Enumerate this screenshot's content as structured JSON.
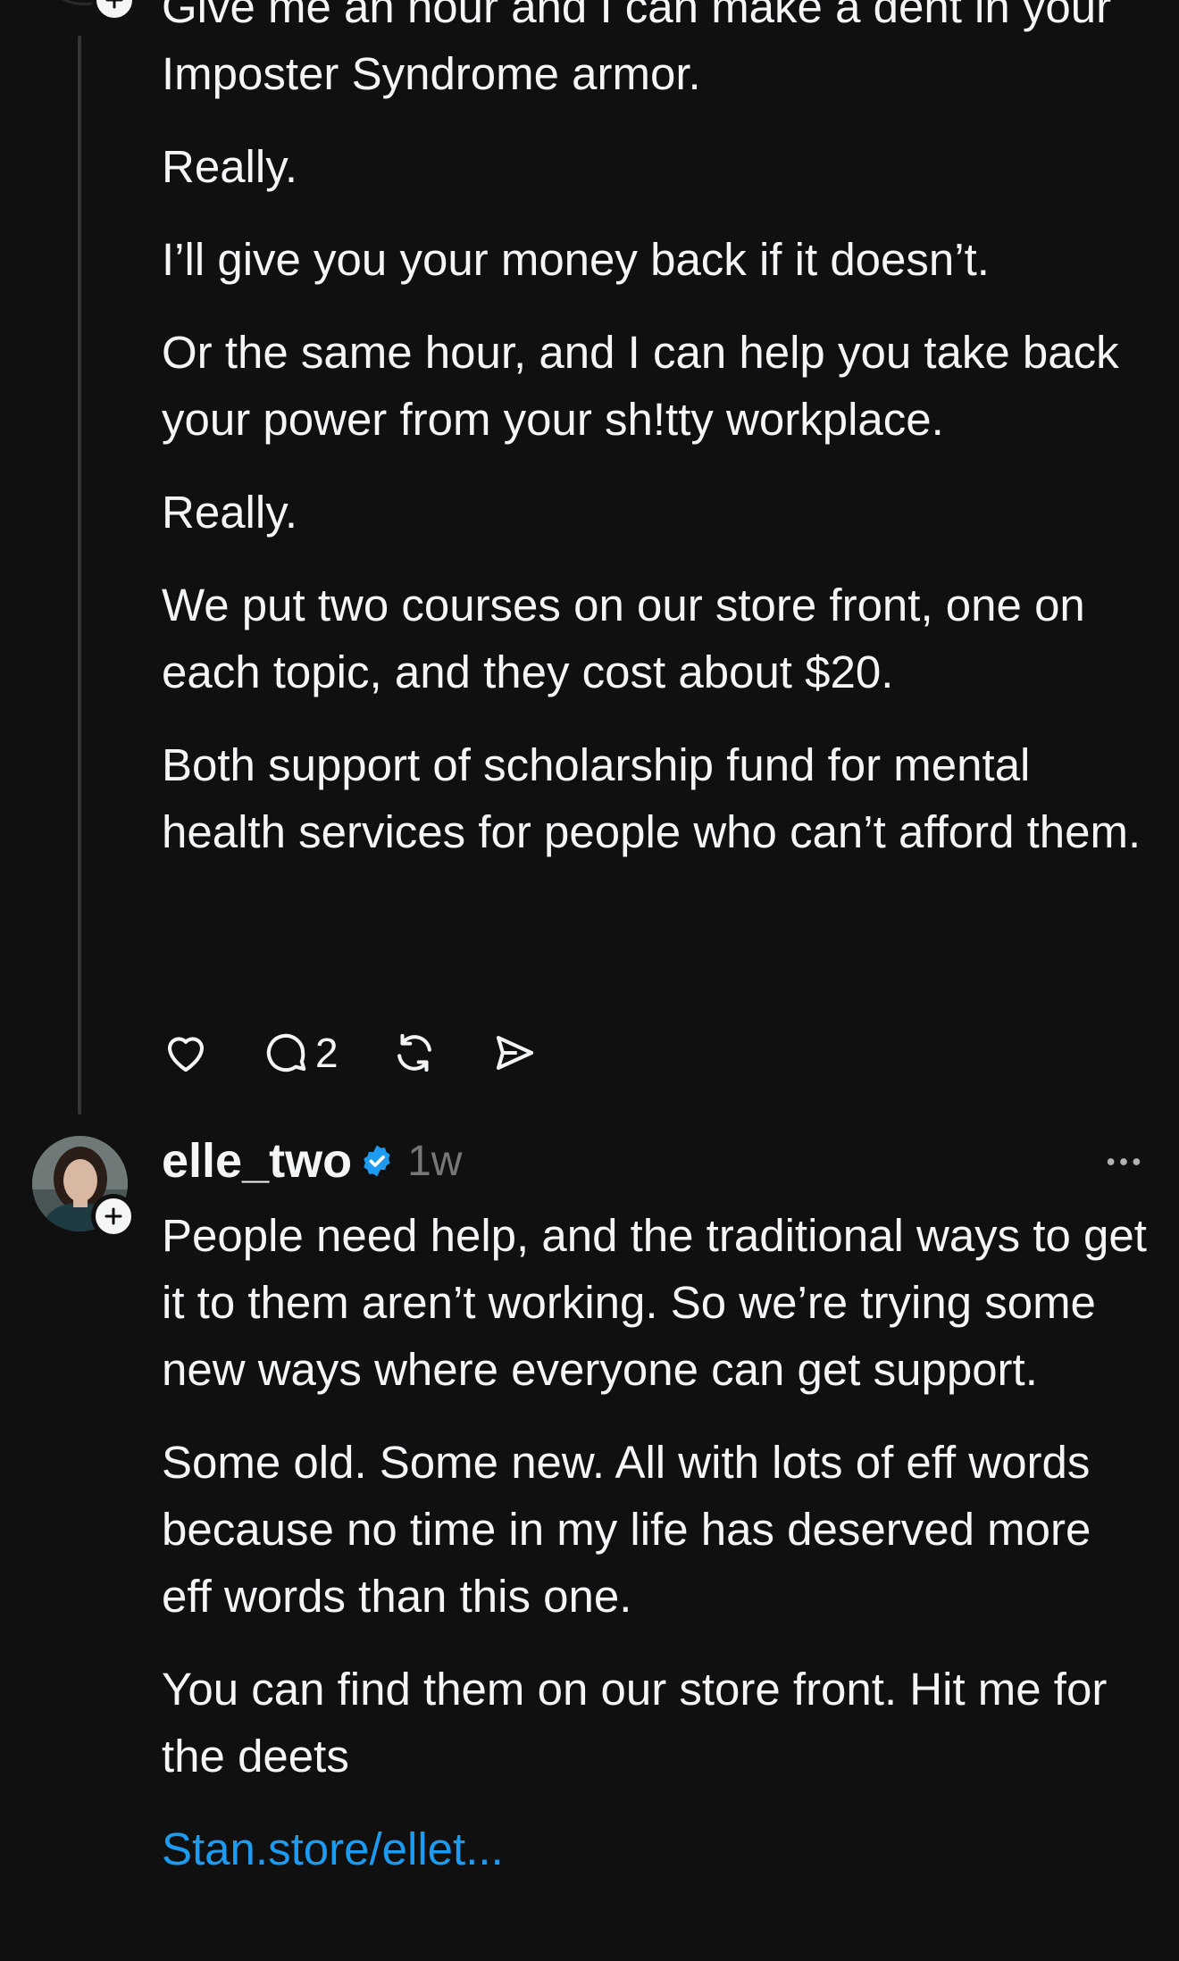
{
  "post1": {
    "paragraphs": [
      "Give me an hour and I can make a dent in your Imposter Syndrome armor.",
      "Really.",
      "I’ll give you your money back if it doesn’t.",
      "Or the same hour, and I can help you take back your power from your sh!tty workplace.",
      "Really.",
      "We put two courses on our store front, one on each topic, and they cost about $20.",
      "Both support of scholarship fund for mental health services for people who can’t afford them."
    ],
    "actions": {
      "like_icon": "heart-icon",
      "reply_icon": "comment-icon",
      "reply_count": "2",
      "repost_icon": "repost-icon",
      "share_icon": "send-icon"
    }
  },
  "post2": {
    "username": "elle_two",
    "time": "1w",
    "verified_color": "#1d9bf0",
    "paragraphs": [
      "People need help, and the traditional ways to get it to them aren’t working. So we’re trying some new ways where everyone can get support.",
      "Some old. Some new. All with lots of eff words because no time in my life has deserved more eff words than this one.",
      "You can find them on our store front. Hit me for the deets"
    ],
    "link": "Stan.store/ellet..."
  },
  "colors": {
    "background": "#101010",
    "text": "#f3f5f7",
    "muted": "#777777",
    "link": "#1d9bf0",
    "thread_line": "#333638"
  }
}
